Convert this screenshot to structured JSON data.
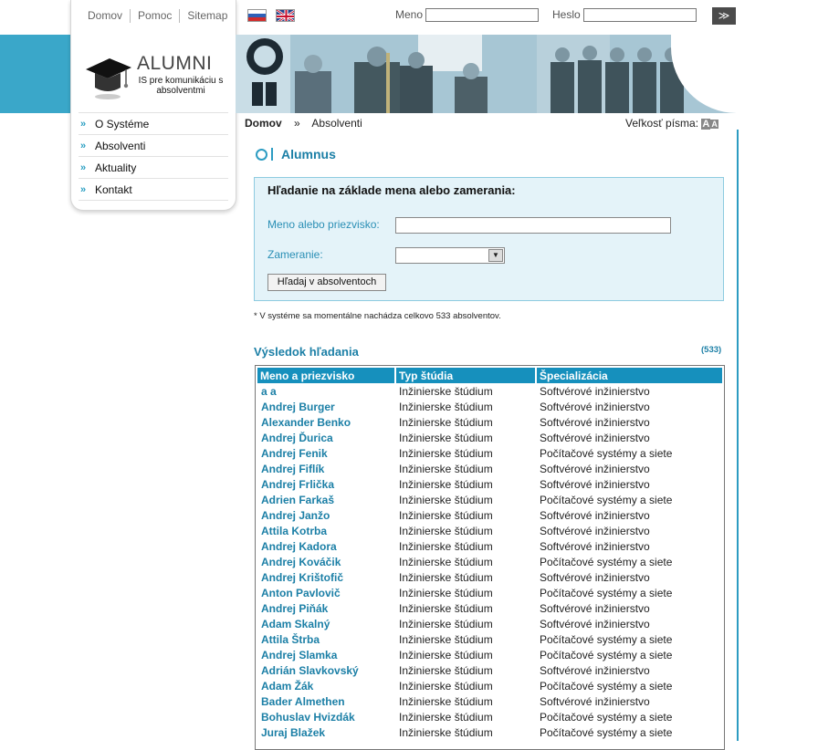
{
  "nav_top": [
    "Domov",
    "Pomoc",
    "Sitemap"
  ],
  "logo": {
    "title": "ALUMNI",
    "subtitle": "IS pre komunikáciu s absolventmi"
  },
  "sidebar": [
    {
      "label": "O Systéme"
    },
    {
      "label": "Absolventi"
    },
    {
      "label": "Aktuality"
    },
    {
      "label": "Kontakt"
    }
  ],
  "header": {
    "flags": [
      "flag-sk-icon",
      "flag-uk-icon"
    ],
    "login_label": "Meno",
    "password_label": "Heslo",
    "go_symbol": "≫"
  },
  "breadcrumb": {
    "home": "Domov",
    "separator": "»",
    "current": "Absolventi"
  },
  "font_size": {
    "label": "Veľkosť písma:",
    "a_small": "A",
    "a_large": "A"
  },
  "page": {
    "title": "Alumnus",
    "search": {
      "heading": "Hľadanie na základe mena alebo zamerania:",
      "name_label": "Meno alebo priezvisko:",
      "name_value": "",
      "focus_label": "Zameranie:",
      "focus_value": "",
      "button": "Hľadaj v absolventoch"
    },
    "note": "* V systéme sa momentálne nachádza celkovo 533 absolventov.",
    "results_title": "Výsledok hľadania",
    "results_count": "(533)",
    "columns": [
      "Meno a priezvisko",
      "Typ štúdia",
      "Špecializácia"
    ],
    "rows": [
      [
        "a a",
        "Inžinierske štúdium",
        "Softvérové inžinierstvo"
      ],
      [
        "Andrej Burger",
        "Inžinierske štúdium",
        "Softvérové inžinierstvo"
      ],
      [
        "Alexander Benko",
        "Inžinierske štúdium",
        "Softvérové inžinierstvo"
      ],
      [
        "Andrej Ďurica",
        "Inžinierske štúdium",
        "Softvérové inžinierstvo"
      ],
      [
        "Andrej Fenik",
        "Inžinierske štúdium",
        "Počítačové systémy a siete"
      ],
      [
        "Andrej Fiflík",
        "Inžinierske štúdium",
        "Softvérové inžinierstvo"
      ],
      [
        "Andrej Frlička",
        "Inžinierske štúdium",
        "Softvérové inžinierstvo"
      ],
      [
        "Adrien Farkaš",
        "Inžinierske štúdium",
        "Počítačové systémy a siete"
      ],
      [
        "Andrej Janžo",
        "Inžinierske štúdium",
        "Softvérové inžinierstvo"
      ],
      [
        "Attila Kotrba",
        "Inžinierske štúdium",
        "Softvérové inžinierstvo"
      ],
      [
        "Andrej Kadora",
        "Inžinierske štúdium",
        "Softvérové inžinierstvo"
      ],
      [
        "Andrej Kováčik",
        "Inžinierske štúdium",
        "Počítačové systémy a siete"
      ],
      [
        "Andrej Krištofič",
        "Inžinierske štúdium",
        "Softvérové inžinierstvo"
      ],
      [
        "Anton Pavlovič",
        "Inžinierske štúdium",
        "Počítačové systémy a siete"
      ],
      [
        "Andrej Piňák",
        "Inžinierske štúdium",
        "Softvérové inžinierstvo"
      ],
      [
        "Adam Skalný",
        "Inžinierske štúdium",
        "Softvérové inžinierstvo"
      ],
      [
        "Attila Štrba",
        "Inžinierske štúdium",
        "Počítačové systémy a siete"
      ],
      [
        "Andrej Slamka",
        "Inžinierske štúdium",
        "Počítačové systémy a siete"
      ],
      [
        "Adrián Slavkovský",
        "Inžinierske štúdium",
        "Softvérové inžinierstvo"
      ],
      [
        "Adam Žák",
        "Inžinierske štúdium",
        "Počítačové systémy a siete"
      ],
      [
        "Bader Almethen",
        "Inžinierske štúdium",
        "Softvérové inžinierstvo"
      ],
      [
        "Bohuslav Hvizdák",
        "Inžinierske štúdium",
        "Počítačové systémy a siete"
      ],
      [
        "Juraj Blažek",
        "Inžinierske štúdium",
        "Počítačové systémy a siete"
      ]
    ]
  },
  "colors": {
    "accent": "#2d9cc2",
    "link": "#1b7fa6",
    "header_bg": "#1690bd",
    "search_bg": "#e4f3f9"
  }
}
